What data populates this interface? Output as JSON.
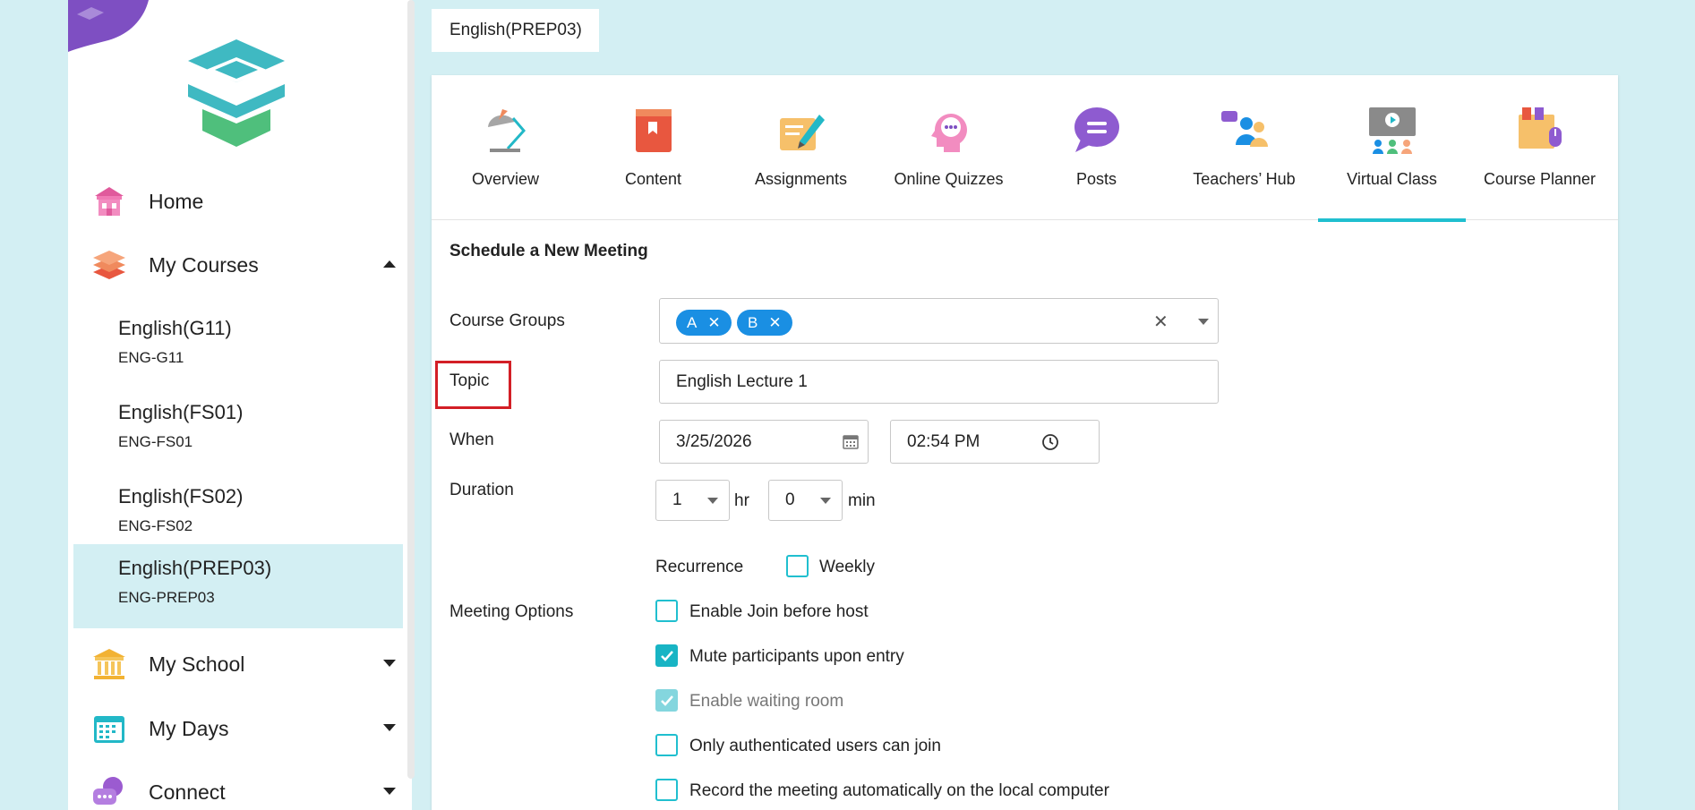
{
  "sidebar": {
    "nav": {
      "home": "Home",
      "my_courses": "My Courses",
      "my_school": "My School",
      "my_days": "My Days",
      "connect": "Connect"
    },
    "courses": [
      {
        "name": "English(G11)",
        "code": "ENG-G11"
      },
      {
        "name": "English(FS01)",
        "code": "ENG-FS01"
      },
      {
        "name": "English(FS02)",
        "code": "ENG-FS02"
      },
      {
        "name": "English(PREP03)",
        "code": "ENG-PREP03"
      }
    ]
  },
  "header": {
    "course_chip": "English(PREP03)"
  },
  "tabs": [
    {
      "label": "Overview"
    },
    {
      "label": "Content"
    },
    {
      "label": "Assignments"
    },
    {
      "label": "Online Quizzes"
    },
    {
      "label": "Posts"
    },
    {
      "label": "Teachers’ Hub"
    },
    {
      "label": "Virtual Class"
    },
    {
      "label": "Course Planner"
    }
  ],
  "form": {
    "title": "Schedule a New Meeting",
    "course_groups_label": "Course Groups",
    "groups": [
      "A",
      "B"
    ],
    "topic_label": "Topic",
    "topic_value": "English Lecture 1",
    "when_label": "When",
    "date_value": "3/25/2026",
    "time_value": "02:54 PM",
    "duration_label": "Duration",
    "hours_value": "1",
    "hours_unit": "hr",
    "minutes_value": "0",
    "minutes_unit": "min",
    "recurrence_label": "Recurrence",
    "weekly_label": "Weekly",
    "meeting_options_label": "Meeting Options",
    "options": [
      {
        "label": "Enable Join before host",
        "checked": false,
        "disabled": false
      },
      {
        "label": "Mute participants upon entry",
        "checked": true,
        "disabled": false
      },
      {
        "label": "Enable waiting room",
        "checked": true,
        "disabled": true
      },
      {
        "label": "Only authenticated users can join",
        "checked": false,
        "disabled": false
      },
      {
        "label": "Record the meeting automatically on the local computer",
        "checked": false,
        "disabled": false
      }
    ]
  },
  "colors": {
    "accent": "#20bfcf",
    "pill": "#1a8fe3",
    "highlight": "#d31f26",
    "background": "#d3eff3"
  }
}
